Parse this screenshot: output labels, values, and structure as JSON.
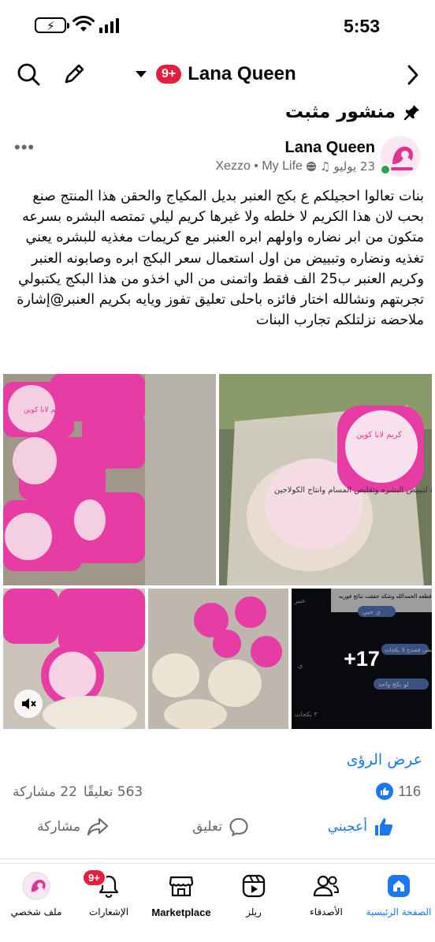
{
  "status_bar": {
    "time": "5:53"
  },
  "header": {
    "page_name": "Lana Queen",
    "badge": "9+"
  },
  "pinned": {
    "label": "منشور مثبت"
  },
  "post": {
    "author": "Lana Queen",
    "date": "23 يوليو",
    "source": "Xezzo • My Life",
    "text": "بنات تعالوا احجيلكم ع بكج العنبر بديل المكياج  والحقن هذا المنتج صنع بحب لان هذا الكريم لا خلطه ولا غيرها كريم ليلي تمتصه البشره بسرعه متكون من ابر نضاره واولهم ابره العنبر مع كريمات مغذيه للبشره يعني تغذيه ونضاره وتبييض من اول استعمال سعر البكج ابره وصابونه العنبر وكريم العنبر ب25 الف فقط واتمنى من الي اخذو من هذا البكج يكتبولي تجربتهم ونشالله اختار فائزه باحلى تعليق تفوز ويايه بكريم العنبر@إشارة ملاحضه نزلتلكم تجارب البنات",
    "images": [
      {
        "name": "image-cream-jars-pink",
        "alt": "pink cream jars"
      },
      {
        "name": "image-soap-package",
        "alt": "soap package"
      },
      {
        "name": "image-cream-video",
        "alt": "cream video"
      },
      {
        "name": "image-products-collage",
        "alt": "products"
      },
      {
        "name": "image-chat-screenshot",
        "alt": "chat screenshot"
      }
    ],
    "more_count": "+17",
    "image_text": {
      "jar_label": "كريم لانا كوين",
      "soap_label": "صابونه الرز والحليب لتبييض البشره وتقليص المسام وانتاج الكولاجين",
      "chat_header": "الي يحب بكج العنبر يرجع يطلب اكثر من قطعه الحمدالله وشكد حققت نتائج فوريه",
      "chat_msg1": "ي حبي",
      "chat_msg2": "يعني قصدج 3 بكجات",
      "chat_msg3": "لو بكج واحد",
      "chat_side1": "عنبر",
      "chat_side2": "ي",
      "chat_side3": "٣ بكجات"
    },
    "insights_label": "عرض الرؤى",
    "likes": "116",
    "comments": "563 تعليقًا",
    "shares": "22 مشاركة",
    "actions": {
      "like": "أعجبني",
      "comment": "تعليق",
      "share": "مشاركة"
    }
  },
  "tabs": [
    {
      "label": "الصفحة الرئيسية",
      "icon": "home-icon",
      "active": true
    },
    {
      "label": "الأصدقاء",
      "icon": "friends-icon"
    },
    {
      "label": "ريلز",
      "icon": "reels-icon"
    },
    {
      "label": "Marketplace",
      "icon": "marketplace-icon"
    },
    {
      "label": "الإشعارات",
      "icon": "bell-icon",
      "badge": "9+"
    },
    {
      "label": "ملف شخصي",
      "icon": "profile-avatar"
    }
  ],
  "colors": {
    "accent": "#1877f2",
    "badge": "#e41e3f",
    "muted": "#65676b",
    "brand_pink": "#e0358f"
  }
}
